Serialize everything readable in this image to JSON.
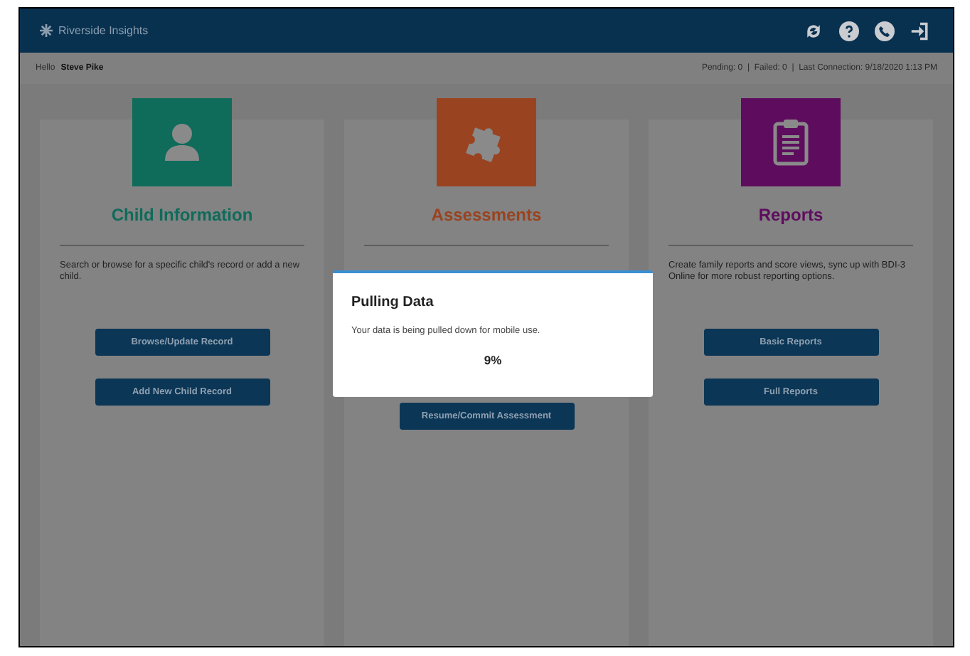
{
  "header": {
    "title": "Riverside Insights",
    "icons": [
      {
        "kind": "sync"
      },
      {
        "kind": "help"
      },
      {
        "kind": "phone"
      },
      {
        "kind": "logout"
      }
    ]
  },
  "subheader": {
    "greeting": "Hello",
    "name": "Steve Pike",
    "status": "Pending: 0  |  Failed: 0  |  Last Connection: 9/18/2020 1:13 PM"
  },
  "cards": [
    {
      "kind": "person",
      "title": "Child Information",
      "color": "#0f6b5a",
      "description": "Search or browse for a specific child's record or add a new child.",
      "buttons": [
        "Browse/Update Record",
        "Add New Child Record"
      ]
    },
    {
      "kind": "puzzle",
      "title": "Assessments",
      "color": "#9a4320",
      "buttons": [
        "Resume/Commit Assessment"
      ]
    },
    {
      "kind": "clipboard",
      "title": "Reports",
      "color": "#5e0c5e",
      "description": "Create family reports and score views, sync up with BDI-3 Online for more robust reporting options.",
      "buttons": [
        "Basic Reports",
        "Full Reports"
      ]
    }
  ],
  "dialog": {
    "title": "Pulling Data",
    "message": "Your data is being pulled down for mobile use.",
    "percent": "9%"
  }
}
